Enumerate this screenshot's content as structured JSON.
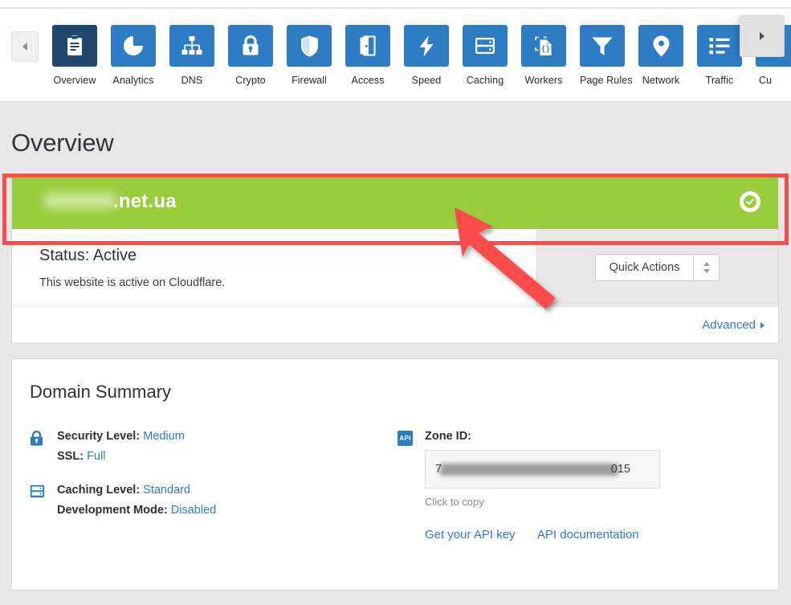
{
  "nav": {
    "scroll_left_icon": "chevron-left-icon",
    "scroll_right_icon": "chevron-right-icon",
    "items": [
      {
        "label": "Overview",
        "icon": "clipboard-icon",
        "active": true
      },
      {
        "label": "Analytics",
        "icon": "pie-chart-icon",
        "active": false
      },
      {
        "label": "DNS",
        "icon": "sitemap-icon",
        "active": false
      },
      {
        "label": "Crypto",
        "icon": "lock-icon",
        "active": false
      },
      {
        "label": "Firewall",
        "icon": "shield-icon",
        "active": false
      },
      {
        "label": "Access",
        "icon": "door-icon",
        "active": false
      },
      {
        "label": "Speed",
        "icon": "lightning-icon",
        "active": false
      },
      {
        "label": "Caching",
        "icon": "database-icon",
        "active": false
      },
      {
        "label": "Workers",
        "icon": "code-file-icon",
        "active": false
      },
      {
        "label": "Page Rules",
        "icon": "funnel-icon",
        "active": false
      },
      {
        "label": "Network",
        "icon": "map-pin-icon",
        "active": false
      },
      {
        "label": "Traffic",
        "icon": "list-icon",
        "active": false
      },
      {
        "label": "Cu",
        "icon": "cut-off-icon",
        "active": false
      }
    ]
  },
  "page": {
    "title": "Overview"
  },
  "zone": {
    "name_suffix": ".net.ua",
    "name_redacted": true,
    "status_icon": "check-circle-icon",
    "banner_color": "#9acd3c"
  },
  "status": {
    "heading": "Status: Active",
    "description": "This website is active on Cloudflare.",
    "quick_actions_label": "Quick Actions",
    "quick_actions_icon": "stepper-updown-icon",
    "advanced_label": "Advanced",
    "advanced_icon": "chevron-right-icon"
  },
  "summary": {
    "title": "Domain Summary",
    "groups": [
      {
        "icon": "lock-icon",
        "lines": [
          {
            "label": "Security Level:",
            "value": "Medium"
          },
          {
            "label": "SSL:",
            "value": "Full"
          }
        ]
      },
      {
        "icon": "database-icon",
        "lines": [
          {
            "label": "Caching Level:",
            "value": "Standard"
          },
          {
            "label": "Development Mode:",
            "value": "Disabled"
          }
        ]
      }
    ],
    "api": {
      "badge_icon": "api-badge-icon",
      "badge_text": "API",
      "zone_id_label": "Zone ID:",
      "zone_id_prefix": "7",
      "zone_id_suffix": "015",
      "zone_id_redacted": true,
      "click_to_copy": "Click to copy",
      "links": [
        {
          "label": "Get your API key"
        },
        {
          "label": "API documentation"
        }
      ]
    }
  },
  "annotation": {
    "highlight_color": "#fb4c4c",
    "arrow_icon": "pointer-arrow-icon",
    "box_icon": "highlight-box-icon"
  },
  "colors": {
    "brand_blue": "#2e7cc4",
    "active_navy": "#21496e",
    "link_blue": "#2f7cc8",
    "success_green": "#9acd3c",
    "annotation_red": "#fb4c4c",
    "page_bg": "#e7e7e7"
  }
}
